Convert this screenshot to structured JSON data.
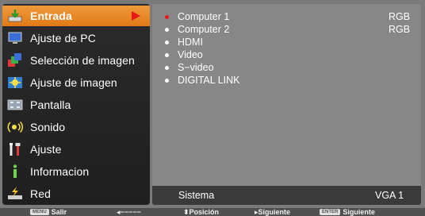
{
  "menu": {
    "items": [
      {
        "label": "Entrada",
        "icon": "input-icon"
      },
      {
        "label": "Ajuste de PC",
        "icon": "pc-adjust-icon"
      },
      {
        "label": "Selección de imagen",
        "icon": "image-select-icon"
      },
      {
        "label": "Ajuste de imagen",
        "icon": "image-adjust-icon"
      },
      {
        "label": "Pantalla",
        "icon": "screen-icon"
      },
      {
        "label": "Sonido",
        "icon": "sound-icon"
      },
      {
        "label": "Ajuste",
        "icon": "setting-icon"
      },
      {
        "label": "Informacion",
        "icon": "information-icon"
      },
      {
        "label": "Red",
        "icon": "network-icon"
      }
    ]
  },
  "options": [
    {
      "label": "Computer 1",
      "value": "RGB",
      "selected": true
    },
    {
      "label": "Computer 2",
      "value": "RGB",
      "selected": false
    },
    {
      "label": "HDMI",
      "value": "",
      "selected": false
    },
    {
      "label": "Video",
      "value": "",
      "selected": false
    },
    {
      "label": "S−video",
      "value": "",
      "selected": false
    },
    {
      "label": "DIGITAL LINK",
      "value": "",
      "selected": false
    }
  ],
  "system": {
    "label": "Sistema",
    "value": "VGA 1"
  },
  "hints": {
    "menu_key": "MENU",
    "exit": "Salir",
    "back": "◂−−−−−",
    "position": "⬍Posición",
    "next_arrow": "▸Siguiente",
    "enter_key": "ENTER",
    "next": "Siguiente"
  },
  "colors": {
    "accent": "#e8821e",
    "selected_bullet": "#e81818"
  }
}
